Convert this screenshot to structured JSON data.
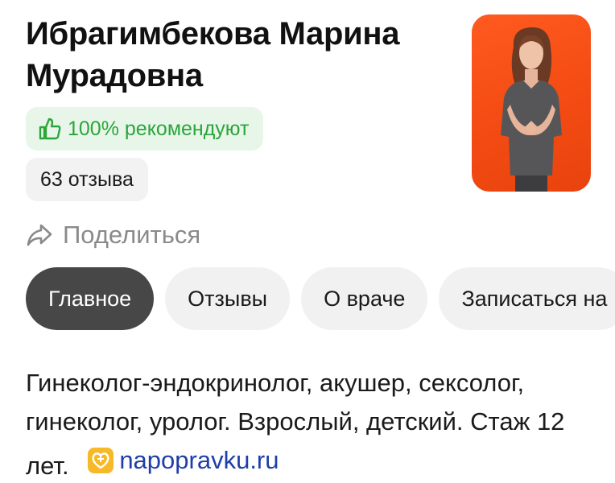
{
  "doctor": {
    "name_line1": "Ибрагимбекова Марина",
    "name_line2": "Мурадовна"
  },
  "badges": {
    "recommend_text": "100% рекомендуют",
    "reviews_text": "63 отзыва"
  },
  "share": {
    "label": "Поделиться"
  },
  "tabs": [
    {
      "label": "Главное",
      "active": true
    },
    {
      "label": "Отзывы",
      "active": false
    },
    {
      "label": "О враче",
      "active": false
    },
    {
      "label": "Записаться на",
      "active": false
    }
  ],
  "description": {
    "text": "Гинеколог-эндокринолог, акушер, сексолог, гинеколог, уролог. Взрослый, детский. Стаж 12 лет.",
    "source_link": "napopravku.ru"
  },
  "colors": {
    "accent_green": "#2aa53a",
    "photo_background": "#f24a12",
    "active_tab": "#474747",
    "link": "#1f3fa8"
  },
  "icons": {
    "recommend": "thumbs-up-icon",
    "share": "share-arrow-icon",
    "source": "napopravku-logo-icon"
  }
}
